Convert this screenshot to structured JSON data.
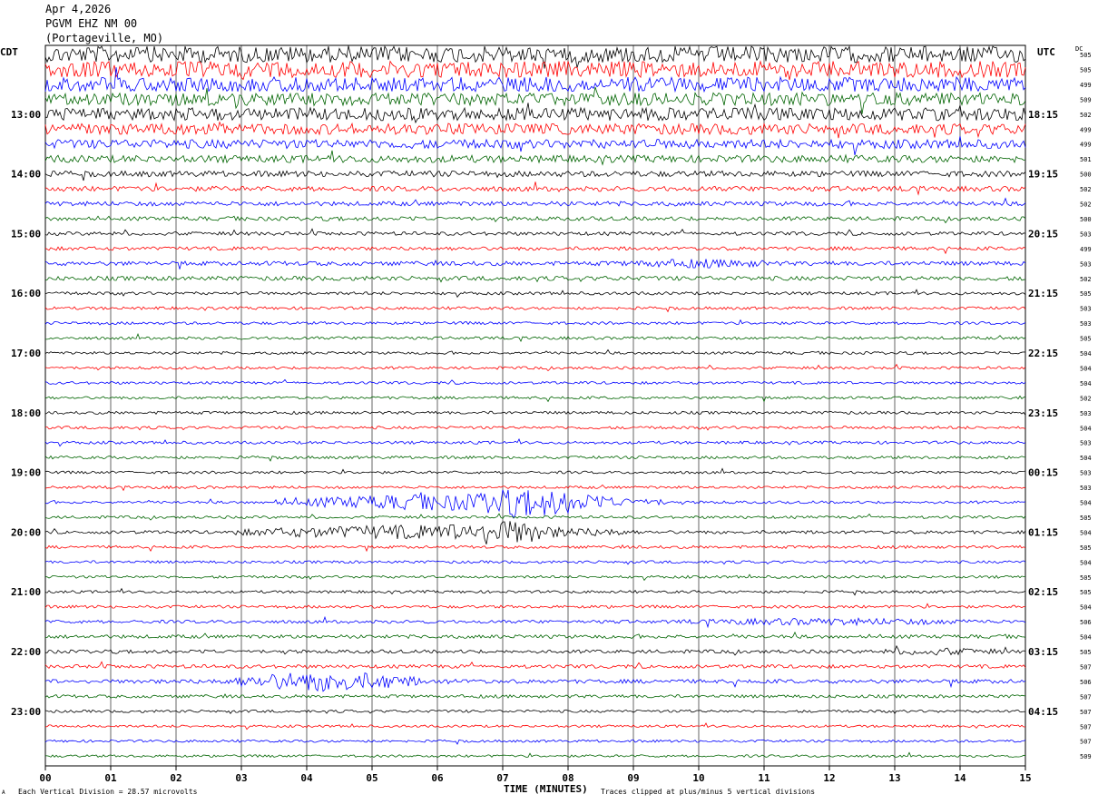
{
  "header": {
    "date": "Apr 4,2026",
    "station": "PGVM EHZ NM 00",
    "location": "(Portageville, MO)"
  },
  "labels": {
    "left_zone": "CDT",
    "right_zone": "UTC",
    "dc_header": "DC",
    "xlabel": "TIME (MINUTES)",
    "scale_note": "Each Vertical Division =   28.57 microvolts",
    "clip_note": "Traces clipped at plus/minus 5 vertical divisions",
    "corner_mark": "A"
  },
  "colors": {
    "trace_cycle": [
      "#000000",
      "#ff0000",
      "#0000ff",
      "#006400"
    ],
    "grid": "#000000",
    "background": "#ffffff"
  },
  "chart_data": {
    "type": "line",
    "title": "",
    "xlabel": "TIME (MINUTES)",
    "xlim": [
      0,
      15
    ],
    "x_ticks": [
      "00",
      "01",
      "02",
      "03",
      "04",
      "05",
      "06",
      "07",
      "08",
      "09",
      "10",
      "11",
      "12",
      "13",
      "14",
      "15"
    ],
    "rows_per_hour": 4,
    "rows": 48,
    "left_hour_labels": [
      {
        "row": 4,
        "label": "13:00"
      },
      {
        "row": 8,
        "label": "14:00"
      },
      {
        "row": 12,
        "label": "15:00"
      },
      {
        "row": 16,
        "label": "16:00"
      },
      {
        "row": 20,
        "label": "17:00"
      },
      {
        "row": 24,
        "label": "18:00"
      },
      {
        "row": 28,
        "label": "19:00"
      },
      {
        "row": 32,
        "label": "20:00"
      },
      {
        "row": 36,
        "label": "21:00"
      },
      {
        "row": 40,
        "label": "22:00"
      },
      {
        "row": 44,
        "label": "23:00"
      }
    ],
    "right_hour_labels": [
      {
        "row": 4,
        "label": "18:15"
      },
      {
        "row": 8,
        "label": "19:15"
      },
      {
        "row": 12,
        "label": "20:15"
      },
      {
        "row": 16,
        "label": "21:15"
      },
      {
        "row": 20,
        "label": "22:15"
      },
      {
        "row": 24,
        "label": "23:15"
      },
      {
        "row": 28,
        "label": "00:15"
      },
      {
        "row": 32,
        "label": "01:15"
      },
      {
        "row": 36,
        "label": "02:15"
      },
      {
        "row": 40,
        "label": "03:15"
      },
      {
        "row": 44,
        "label": "04:15"
      }
    ],
    "dc_offsets": [
      505,
      505,
      499,
      509,
      502,
      499,
      499,
      501,
      500,
      502,
      502,
      500,
      503,
      499,
      503,
      502,
      505,
      503,
      503,
      505,
      504,
      504,
      504,
      502,
      503,
      504,
      503,
      504,
      503,
      503,
      504,
      505,
      504,
      505,
      504,
      505,
      505,
      504,
      506,
      504,
      505,
      507,
      506,
      507,
      507,
      507,
      507,
      509
    ],
    "noise_levels": [
      9,
      9,
      8,
      7,
      7,
      6,
      5,
      4,
      3.2,
      2.8,
      2.5,
      2.2,
      2,
      2,
      2.4,
      2.4,
      1.7,
      1.6,
      1.6,
      1.6,
      1.5,
      1.5,
      1.5,
      1.5,
      1.6,
      1.6,
      1.6,
      1.6,
      1.5,
      1.5,
      1.5,
      1.5,
      1.8,
      1.6,
      1.5,
      1.5,
      1.5,
      1.6,
      1.8,
      2,
      1.9,
      2,
      2.2,
      1.8,
      1.5,
      1.4,
      1.4,
      1.4
    ],
    "events": [
      {
        "row": 14,
        "start": 8.5,
        "end": 11.5,
        "amp": 5
      },
      {
        "row": 30,
        "start": 3.5,
        "end": 9.5,
        "amp": 9
      },
      {
        "row": 30,
        "start": 6.2,
        "end": 8.6,
        "amp": 15
      },
      {
        "row": 32,
        "start": 2.8,
        "end": 9.0,
        "amp": 8
      },
      {
        "row": 32,
        "start": 6.0,
        "end": 7.8,
        "amp": 15
      },
      {
        "row": 38,
        "start": 9.2,
        "end": 15,
        "amp": 4
      },
      {
        "row": 40,
        "start": 12.5,
        "end": 15,
        "amp": 4
      },
      {
        "row": 42,
        "start": 2.8,
        "end": 5.8,
        "amp": 11
      },
      {
        "row": 42,
        "start": 0,
        "end": 9,
        "amp": 3
      }
    ]
  }
}
